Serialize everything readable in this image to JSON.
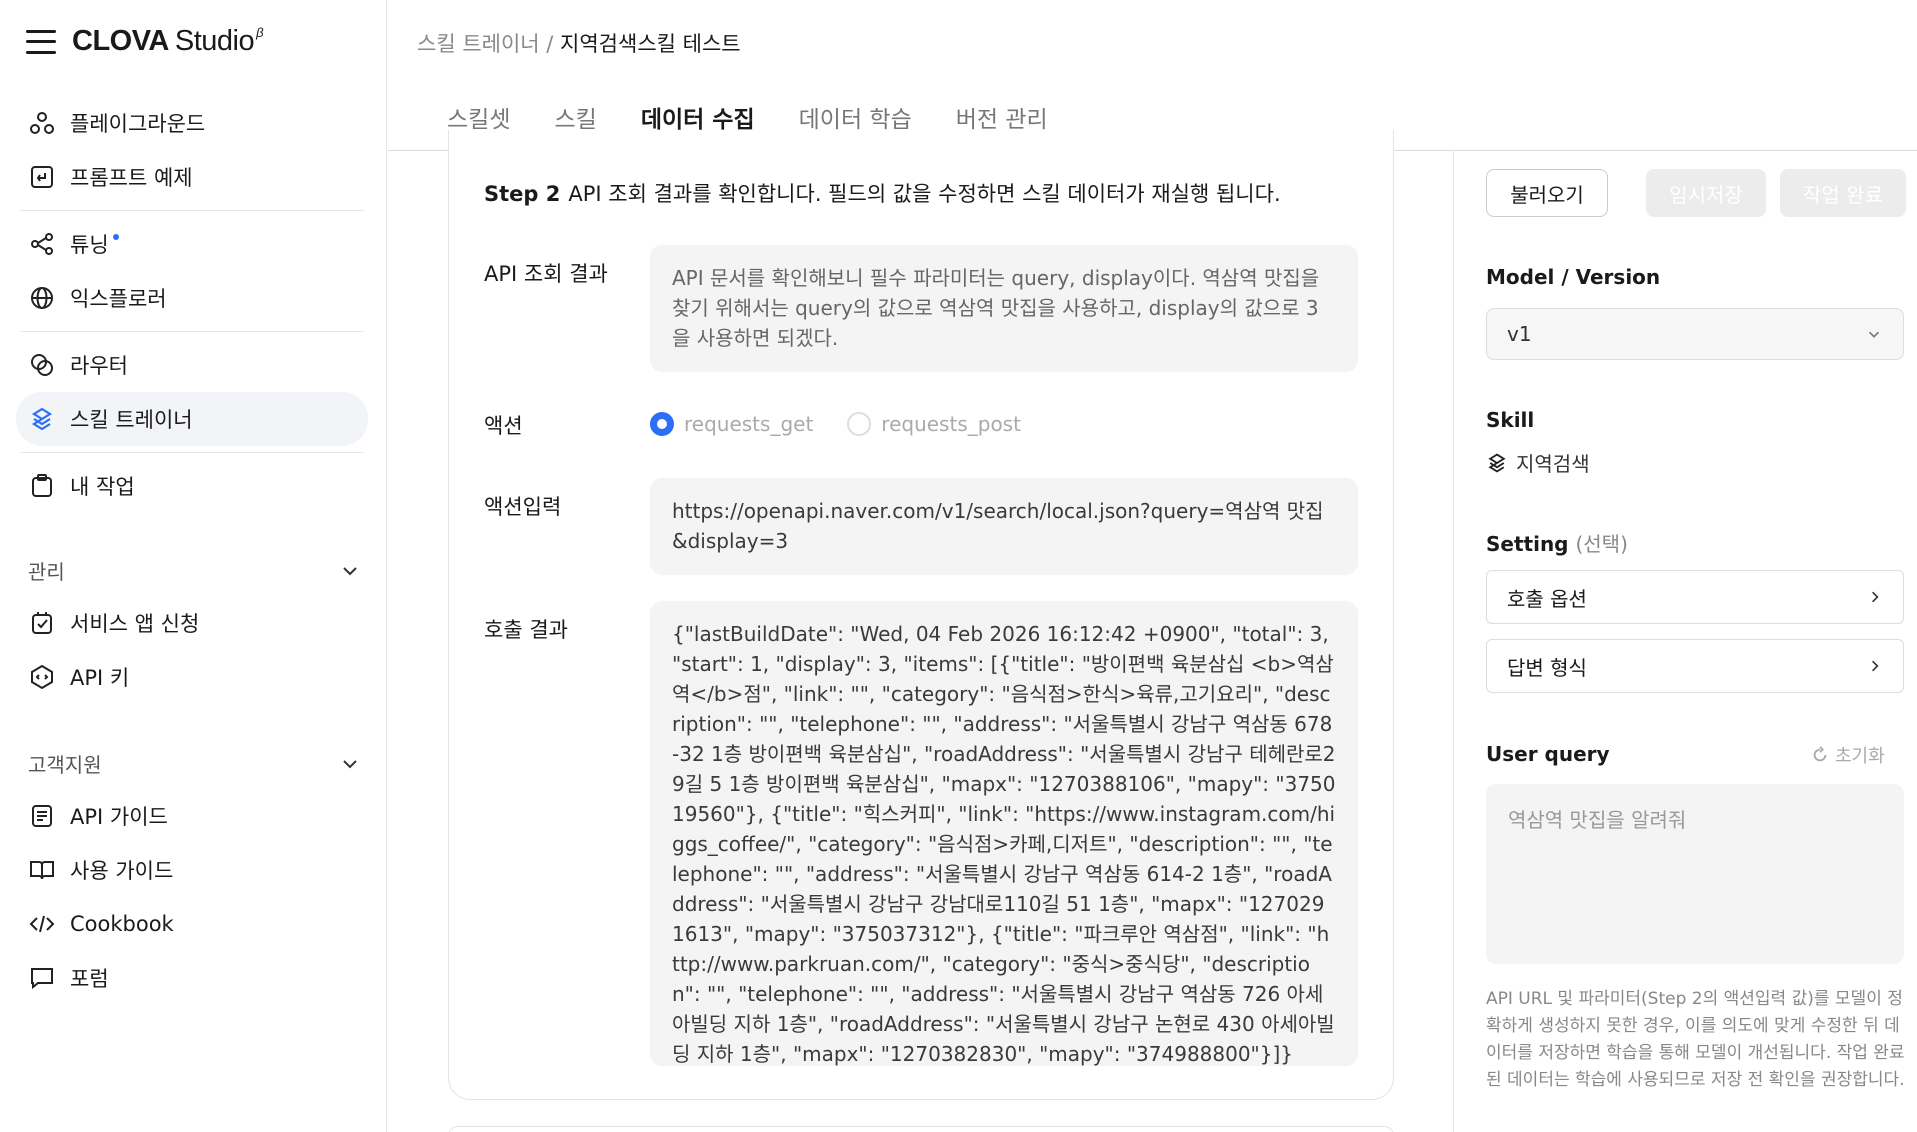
{
  "brand": {
    "name_bold": "CLOVA",
    "name_rest": "Studio",
    "superscript": "β"
  },
  "sidebar": {
    "items": [
      {
        "label": "플레이그라운드",
        "icon": "playground-icon"
      },
      {
        "label": "프롬프트 예제",
        "icon": "prompt-example-icon"
      },
      {
        "label": "튜닝",
        "icon": "tuning-icon"
      },
      {
        "label": "익스플로러",
        "icon": "globe-icon"
      },
      {
        "label": "라우터",
        "icon": "router-icon"
      },
      {
        "label": "스킬 트레이너",
        "icon": "skill-trainer-icon"
      },
      {
        "label": "내 작업",
        "icon": "clipboard-icon"
      }
    ],
    "section_manage": "관리",
    "manage_items": [
      {
        "label": "서비스 앱 신청",
        "icon": "app-check-icon"
      },
      {
        "label": "API 키",
        "icon": "api-key-icon"
      }
    ],
    "section_support": "고객지원",
    "support_items": [
      {
        "label": "API 가이드",
        "icon": "doc-icon"
      },
      {
        "label": "사용 가이드",
        "icon": "book-icon"
      },
      {
        "label": "Cookbook",
        "icon": "code-icon"
      },
      {
        "label": "포럼",
        "icon": "chat-icon"
      }
    ]
  },
  "breadcrumb": {
    "parent": "스킬 트레이너",
    "sep": " / ",
    "current": "지역검색스킬 테스트"
  },
  "tabs": [
    "스킬셋",
    "스킬",
    "데이터 수집",
    "데이터 학습",
    "버전 관리"
  ],
  "main": {
    "step_label": "Step 2",
    "step_text": "API 조회 결과를 확인합니다. 필드의 값을 수정하면 스킬 데이터가 재실행 됩니다.",
    "api_result_label": "API 조회 결과",
    "api_result_text": "API 문서를 확인해보니 필수 파라미터는 query, display이다. 역삼역 맛집을 찾기 위해서는 query의 값으로 역삼역 맛집을 사용하고, display의 값으로 3을 사용하면 되겠다.",
    "action_label": "액션",
    "action_options": [
      "requests_get",
      "requests_post"
    ],
    "action_input_label": "액션입력",
    "action_input_text": "https://openapi.naver.com/v1/search/local.json?query=역삼역 맛집&display=3",
    "call_result_label": "호출 결과",
    "call_result_text": "{\"lastBuildDate\": \"Wed, 04 Feb 2026 16:12:42 +0900\", \"total\": 3, \"start\": 1, \"display\": 3, \"items\": [{\"title\": \"방이편백 육분삼십 <b>역삼역</b>점\", \"link\": \"\", \"category\": \"음식점>한식>육류,고기요리\", \"description\": \"\", \"telephone\": \"\", \"address\": \"서울특별시 강남구 역삼동 678-32 1층 방이편백 육분삼십\", \"roadAddress\": \"서울특별시 강남구 테헤란로29길 5 1층 방이편백 육분삼십\", \"mapx\": \"1270388106\", \"mapy\": \"375019560\"}, {\"title\": \"힉스커피\", \"link\": \"https://www.instagram.com/higgs_coffee/\", \"category\": \"음식점>카페,디저트\", \"description\": \"\", \"telephone\": \"\", \"address\": \"서울특별시 강남구 역삼동 614-2 1층\", \"roadAddress\": \"서울특별시 강남구 강남대로110길 51 1층\", \"mapx\": \"1270291613\", \"mapy\": \"375037312\"}, {\"title\": \"파크루안 역삼점\", \"link\": \"http://www.parkruan.com/\", \"category\": \"중식>중식당\", \"description\": \"\", \"telephone\": \"\", \"address\": \"서울특별시 강남구 역삼동 726 아세아빌딩 지하 1층\", \"roadAddress\": \"서울특별시 강남구 논현로 430 아세아빌딩 지하 1층\", \"mapx\": \"1270382830\", \"mapy\": \"374988800\"}]}"
  },
  "right": {
    "load_button": "불러오기",
    "temp_save_button": "임시저장",
    "complete_button": "작업 완료",
    "model_label": "Model / Version",
    "model_value": "v1",
    "skill_label": "Skill",
    "skill_value": "지역검색",
    "setting_label": "Setting",
    "setting_optional": "(선택)",
    "setting_options": [
      "호출 옵션",
      "답변 형식"
    ],
    "user_query_label": "User query",
    "reset_label": "초기화",
    "user_query_value": "역삼역 맛집을 알려줘",
    "help_text": "API URL 및 파라미터(Step 2의 액션입력 값)를 모델이 정확하게 생성하지 못한 경우, 이를 의도에 맞게 수정한 뒤 데이터를 저장하면 학습을 통해 모델이 개선됩니다. 작업 완료된 데이터는 학습에 사용되므로 저장 전 확인을 권장합니다."
  },
  "colors": {
    "accent": "#2b6ff7",
    "active_bg": "#f2f4f7",
    "box_bg": "#f4f4f5"
  }
}
